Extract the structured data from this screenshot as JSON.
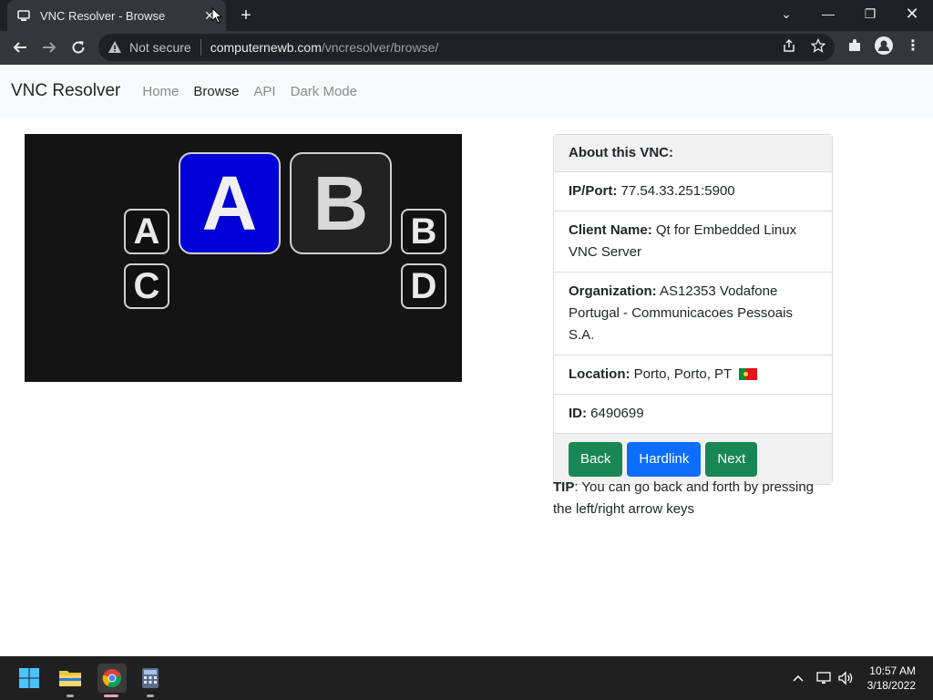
{
  "browser": {
    "tab_title": "VNC Resolver - Browse",
    "not_secure": "Not secure",
    "url_host": "computernewb.com",
    "url_path": "/vncresolver/browse/"
  },
  "site": {
    "brand": "VNC Resolver",
    "nav": [
      "Home",
      "Browse",
      "API",
      "Dark Mode"
    ],
    "active_nav": "Browse"
  },
  "vnc_screenshot": {
    "keys": {
      "left_top": "A",
      "left_bottom": "C",
      "big_left": "A",
      "big_right": "B",
      "right_top": "B",
      "right_bottom": "D"
    },
    "selected_color": "#0000d6"
  },
  "card": {
    "header": "About this VNC:",
    "ip_label": "IP/Port:",
    "ip_value": "77.54.33.251:5900",
    "client_label": "Client Name:",
    "client_value": "Qt for Embedded Linux VNC Server",
    "org_label": "Organization:",
    "org_value": "AS12353 Vodafone Portugal - Communicacoes Pessoais S.A.",
    "location_label": "Location:",
    "location_value": "Porto, Porto, PT",
    "id_label": "ID:",
    "id_value": "6490699",
    "buttons": {
      "back": "Back",
      "hardlink": "Hardlink",
      "next": "Next"
    }
  },
  "tip": {
    "label": "TIP",
    "text": ": You can go back and forth by pressing the left/right arrow keys"
  },
  "taskbar": {
    "time": "10:57 AM",
    "date": "3/18/2022"
  },
  "colors": {
    "btn_green": "#198754",
    "btn_blue": "#0d6efd"
  }
}
